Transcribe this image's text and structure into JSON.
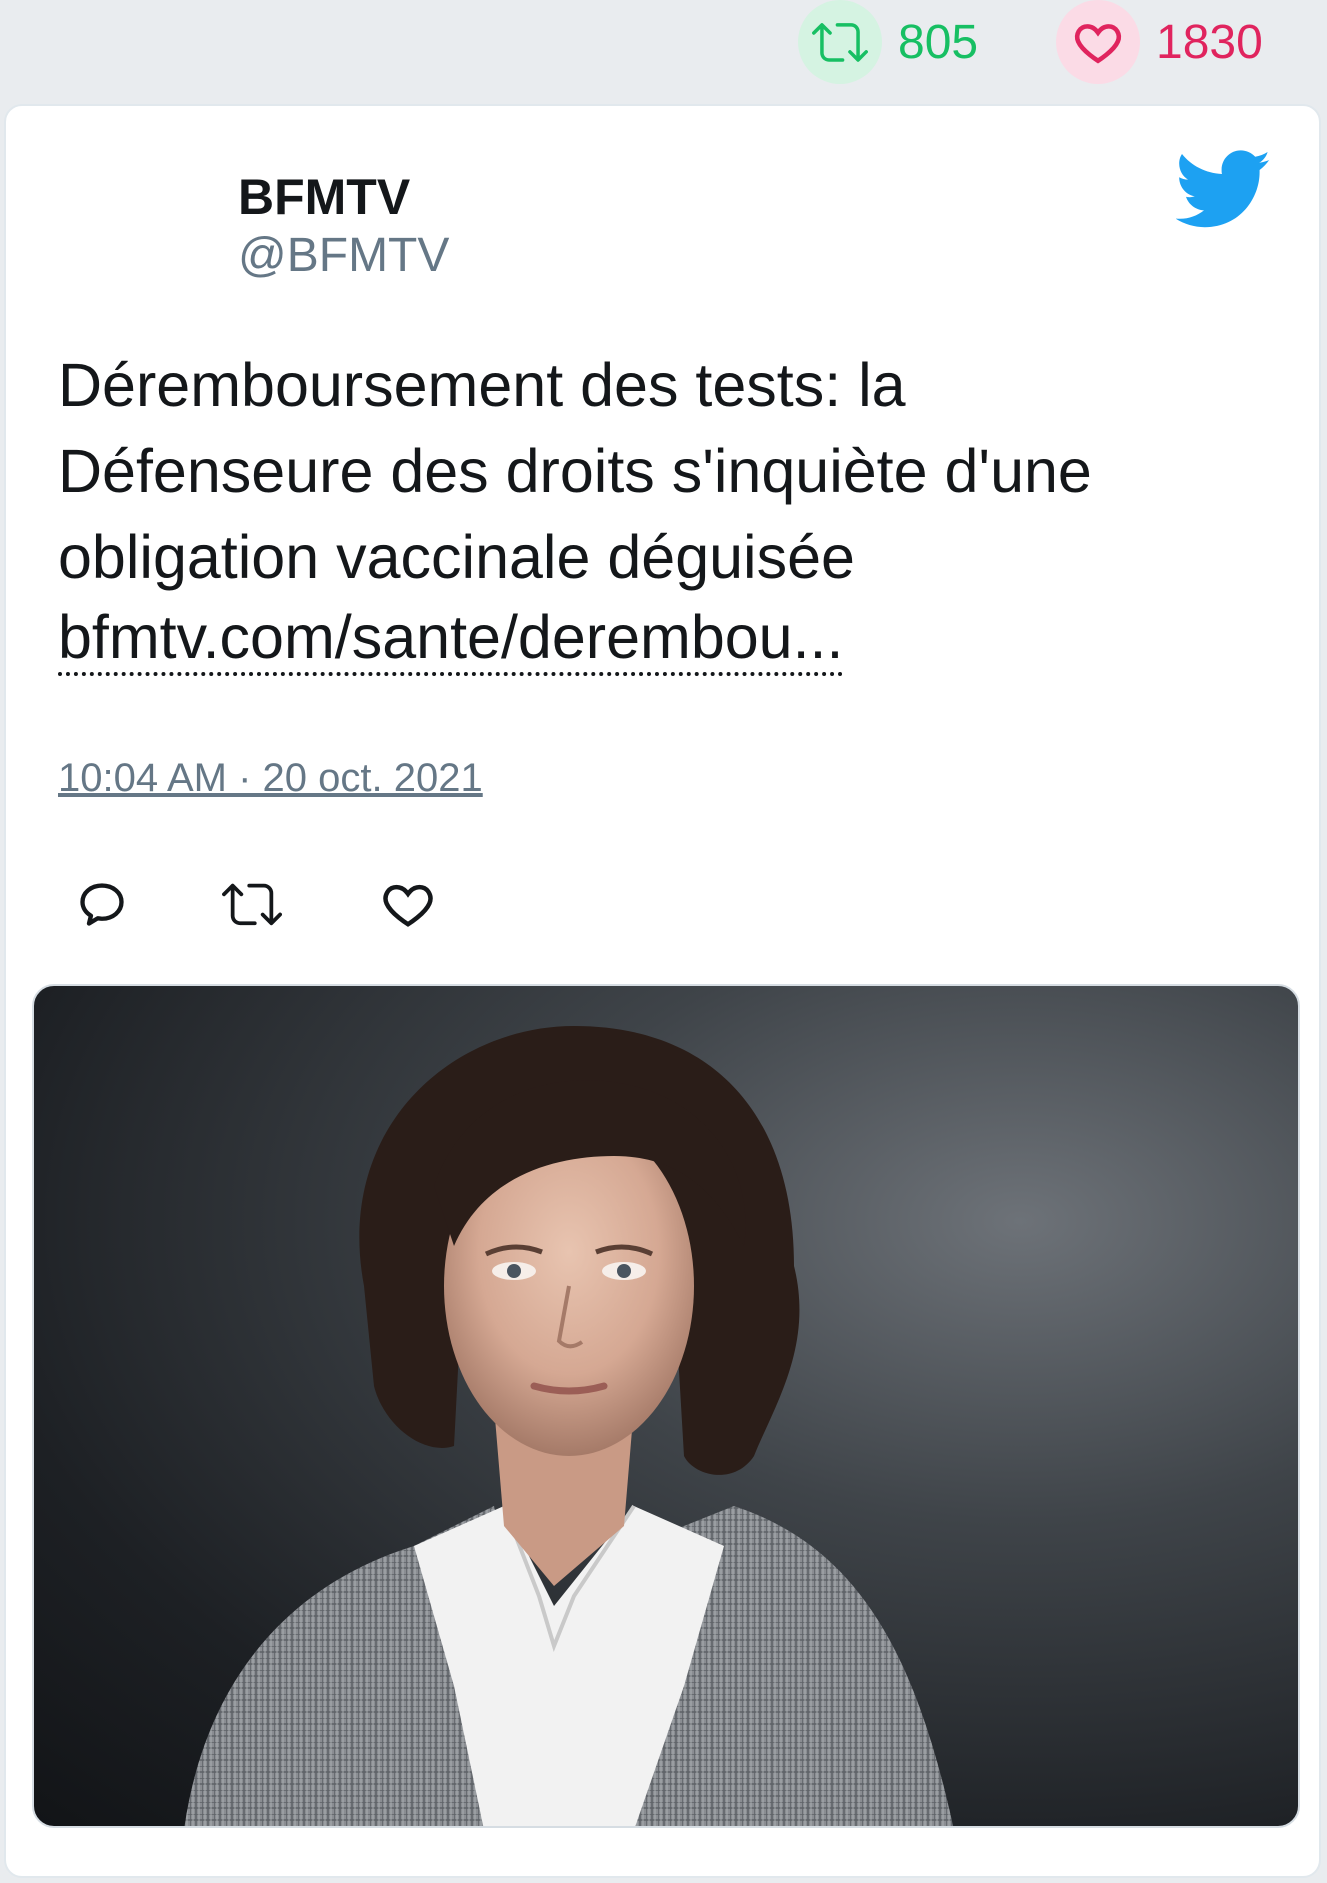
{
  "stats": {
    "retweets": "805",
    "likes": "1830",
    "retweet_color": "#17bf63",
    "like_color": "#e0245e"
  },
  "tweet": {
    "author_name": "BFMTV",
    "author_handle": "@BFMTV",
    "text_lines": [
      "Déremboursement des tests: la",
      "Défenseure des droits s'inquiète d'une",
      "obligation vaccinale déguisée"
    ],
    "link_text": "bfmtv.com/sante/derembou...",
    "timestamp": "10:04 AM · 20 oct. 2021"
  },
  "actions": {
    "icons": [
      "reply-icon",
      "retweet-icon",
      "like-icon"
    ]
  },
  "media": {
    "type": "photo",
    "subject": "portrait"
  },
  "colors": {
    "twitter_blue": "#1da1f2",
    "text_primary": "#14171a",
    "text_secondary": "#657786"
  }
}
